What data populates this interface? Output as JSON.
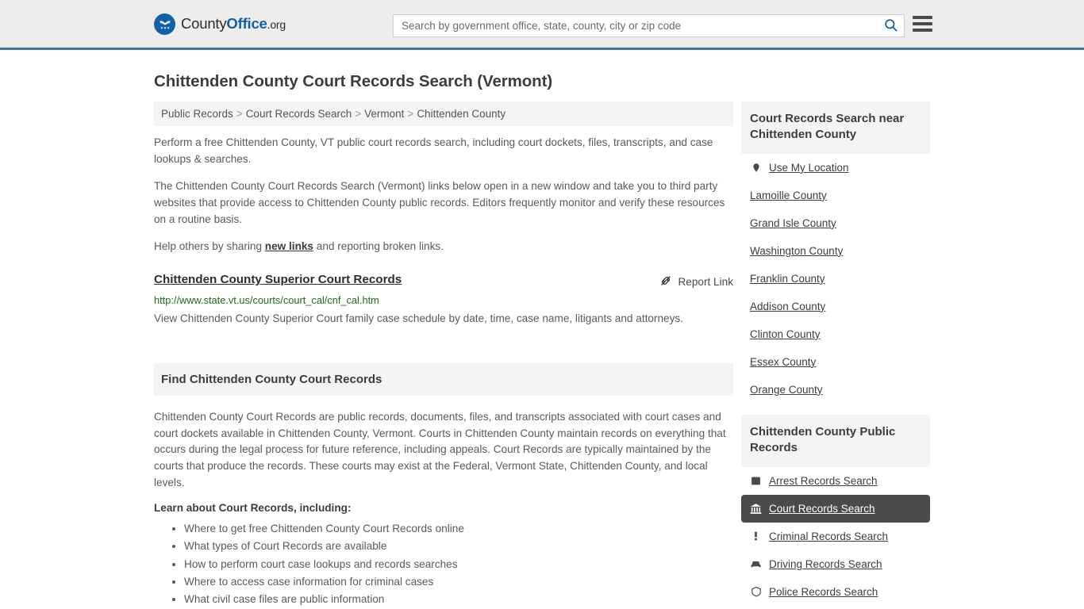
{
  "header": {
    "logo": {
      "icon": "eagle-shield-icon",
      "part1": "County",
      "part2": "Office",
      "part3": ".org"
    },
    "search": {
      "placeholder": "Search by government office, state, county, city or zip code",
      "value": "",
      "search_icon": "search-icon"
    },
    "menu_icon": "hamburger-menu-icon",
    "accent_color": "#3b74a6"
  },
  "page": {
    "title": "Chittenden County Court Records Search (Vermont)"
  },
  "breadcrumb": {
    "separator": ">",
    "items": [
      "Public Records",
      "Court Records Search",
      "Vermont",
      "Chittenden County"
    ]
  },
  "intro": {
    "p1": "Perform a free Chittenden County, VT public court records search, including court dockets, files, transcripts, and case lookups & searches.",
    "p2": "The Chittenden County Court Records Search (Vermont) links below open in a new window and take you to third party websites that provide access to Chittenden County public records. Editors frequently monitor and verify these resources on a routine basis.",
    "p3_before": "Help others by sharing ",
    "p3_link": "new links",
    "p3_after": " and reporting broken links."
  },
  "result": {
    "title": "Chittenden County Superior Court Records",
    "report_label": "Report Link",
    "report_icon": "broken-link-icon",
    "url": "http://www.state.vt.us/courts/court_cal/cnf_cal.htm",
    "description": "View Chittenden County Superior Court family case schedule by date, time, case name, litigants and attorneys."
  },
  "find_section": {
    "heading": "Find Chittenden County Court Records",
    "paragraph": "Chittenden County Court Records are public records, documents, files, and transcripts associated with court cases and court dockets available in Chittenden County, Vermont. Courts in Chittenden County maintain records on everything that occurs during the legal process for future reference, including appeals. Court Records are typically maintained by the courts that produce the records. These courts may exist at the Federal, Vermont State, Chittenden County, and local levels.",
    "lead_in": "Learn about Court Records, including:",
    "bullets": [
      "Where to get free Chittenden County Court Records online",
      "What types of Court Records are available",
      "How to perform court case lookups and records searches",
      "Where to access case information for criminal cases",
      "What civil case files are public information"
    ]
  },
  "sidebar": {
    "near": {
      "heading": "Court Records Search near Chittenden County",
      "items": [
        {
          "label": "Use My Location",
          "icon": "map-pin-icon"
        },
        {
          "label": "Lamoille County",
          "icon": ""
        },
        {
          "label": "Grand Isle County",
          "icon": ""
        },
        {
          "label": "Washington County",
          "icon": ""
        },
        {
          "label": "Franklin County",
          "icon": ""
        },
        {
          "label": "Addison County",
          "icon": ""
        },
        {
          "label": "Clinton County",
          "icon": ""
        },
        {
          "label": "Essex County",
          "icon": ""
        },
        {
          "label": "Orange County",
          "icon": ""
        }
      ]
    },
    "public_records": {
      "heading": "Chittenden County Public Records",
      "active_index": 1,
      "active_color": "#4a4a4a",
      "items": [
        {
          "label": "Arrest Records Search",
          "icon": "fingerprint-card-icon"
        },
        {
          "label": "Court Records Search",
          "icon": "courthouse-icon"
        },
        {
          "label": "Criminal Records Search",
          "icon": "exclamation-icon"
        },
        {
          "label": "Driving Records Search",
          "icon": "car-icon"
        },
        {
          "label": "Police Records Search",
          "icon": "police-badge-icon"
        }
      ]
    }
  }
}
